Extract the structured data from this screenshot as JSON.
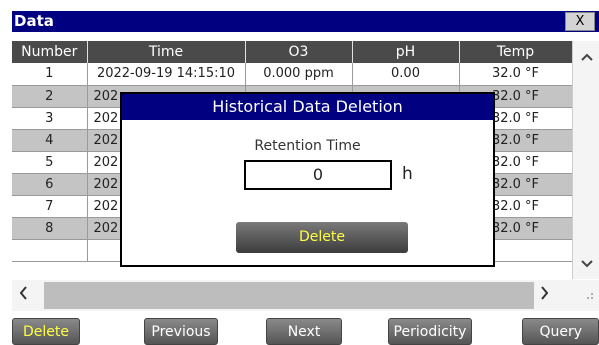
{
  "window": {
    "title": "Data",
    "close_label": "X"
  },
  "table": {
    "headers": [
      "Number",
      "Time",
      "O3",
      "pH",
      "Temp"
    ],
    "rows": [
      [
        "1",
        "2022-09-19 14:15:10",
        "0.000 ppm",
        "0.00",
        "32.0 °F"
      ],
      [
        "2",
        "202",
        "",
        "",
        "32.0 °F"
      ],
      [
        "3",
        "202",
        "",
        "",
        "32.0 °F"
      ],
      [
        "4",
        "202",
        "",
        "",
        "32.0 °F"
      ],
      [
        "5",
        "202",
        "",
        "",
        "32.0 °F"
      ],
      [
        "6",
        "202",
        "",
        "",
        "32.0 °F"
      ],
      [
        "7",
        "202",
        "",
        "",
        "32.0 °F"
      ],
      [
        "8",
        "202",
        "",
        "",
        "32.0 °F"
      ],
      [
        "",
        "",
        "",
        "",
        ""
      ]
    ]
  },
  "scroll": {
    "up": "^",
    "down": "v",
    "left": "<",
    "right": ">"
  },
  "toolbar": {
    "delete": "Delete",
    "previous": "Previous",
    "next": "Next",
    "periodicity": "Periodicity",
    "query": "Query"
  },
  "dialog": {
    "title": "Historical Data Deletion",
    "retention_label": "Retention Time",
    "retention_value": "0",
    "unit": "h",
    "delete": "Delete"
  }
}
